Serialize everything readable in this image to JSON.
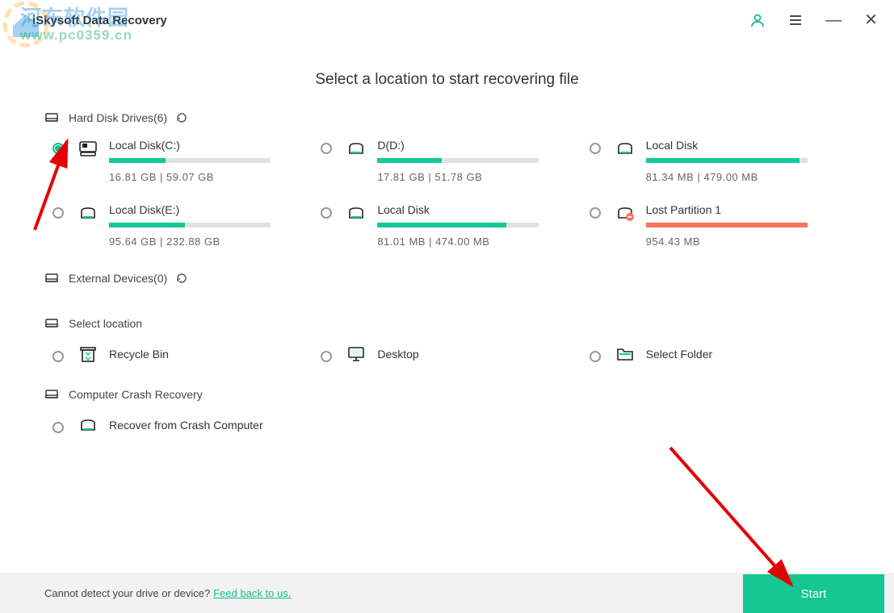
{
  "app": {
    "title": "iSkysoft Data Recovery"
  },
  "watermark": {
    "text": "河东软件园",
    "url": "www.pc0359.cn"
  },
  "mainTitle": "Select a location to start recovering file",
  "sections": {
    "hdd": {
      "label": "Hard Disk Drives(6)"
    },
    "ext": {
      "label": "External Devices(0)"
    },
    "loc": {
      "label": "Select location"
    },
    "crash": {
      "label": "Computer Crash Recovery"
    }
  },
  "drives": [
    {
      "name": "Local Disk(C:)",
      "size": "16.81  GB | 59.07  GB",
      "pct": 35,
      "icon": "system",
      "selected": true
    },
    {
      "name": "D(D:)",
      "size": "17.81  GB | 51.78  GB",
      "pct": 40,
      "icon": "disk",
      "selected": false
    },
    {
      "name": "Local Disk",
      "size": "81.34  MB | 479.00  MB",
      "pct": 95,
      "icon": "disk",
      "selected": false
    },
    {
      "name": "Local Disk(E:)",
      "size": "95.64  GB | 232.88  GB",
      "pct": 47,
      "icon": "disk",
      "selected": false
    },
    {
      "name": "Local Disk",
      "size": "81.01  MB | 474.00  MB",
      "pct": 80,
      "icon": "disk",
      "selected": false
    },
    {
      "name": "Lost Partition 1",
      "size": "954.43  MB",
      "pct": 100,
      "icon": "lost",
      "selected": false,
      "red": true
    }
  ],
  "locations": [
    {
      "name": "Recycle Bin",
      "icon": "recycle"
    },
    {
      "name": "Desktop",
      "icon": "desktop"
    },
    {
      "name": "Select Folder",
      "icon": "folder"
    }
  ],
  "crashItem": {
    "name": "Recover from Crash Computer",
    "icon": "disk"
  },
  "footer": {
    "text": "Cannot detect your drive or device?",
    "link": "Feed back to us."
  },
  "startLabel": "Start"
}
